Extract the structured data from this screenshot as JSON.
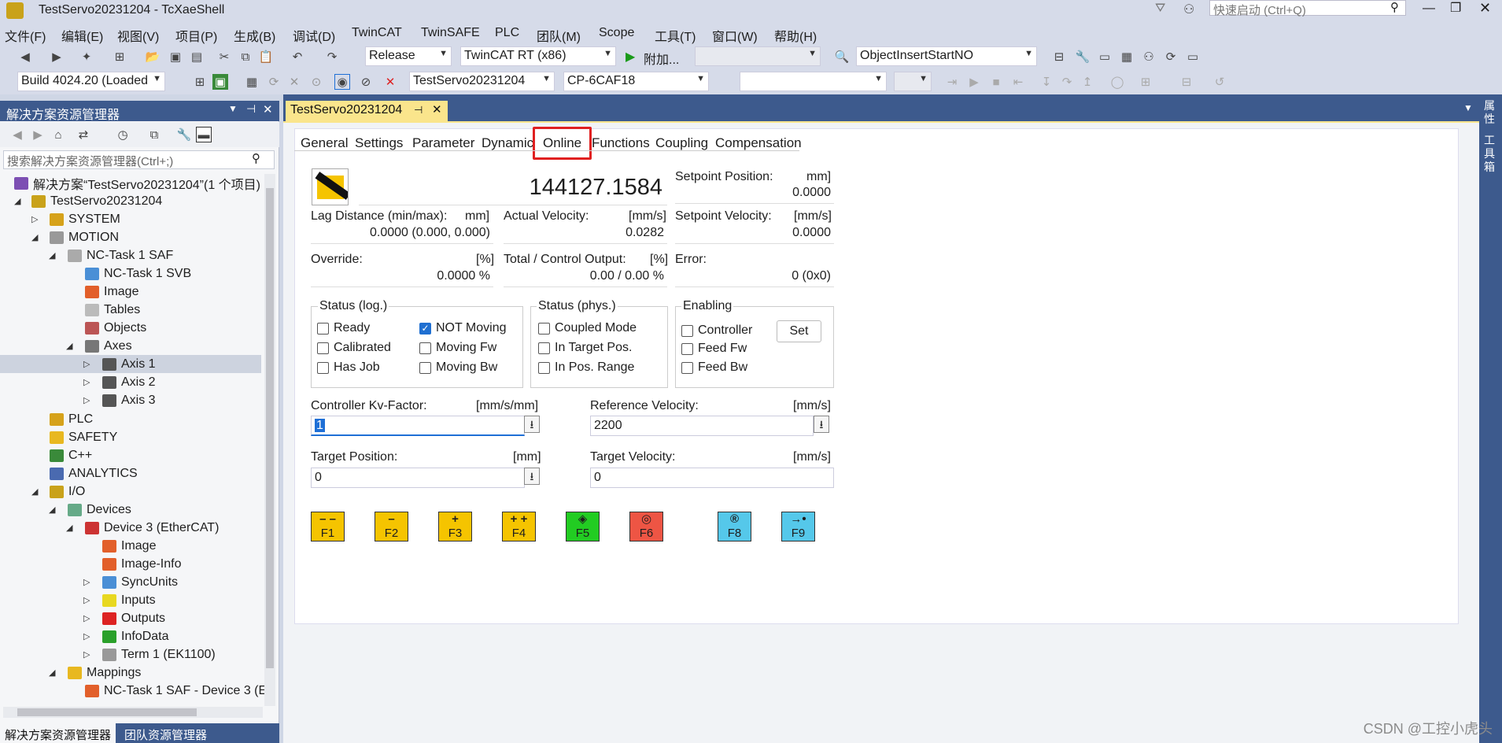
{
  "window": {
    "title": "TestServo20231204 - TcXaeShell",
    "quick_launch": "快速启动 (Ctrl+Q)"
  },
  "menu": [
    "文件(F)",
    "编辑(E)",
    "视图(V)",
    "项目(P)",
    "生成(B)",
    "调试(D)",
    "TwinCAT",
    "TwinSAFE",
    "PLC",
    "团队(M)",
    "Scope",
    "工具(T)",
    "窗口(W)",
    "帮助(H)"
  ],
  "toolbar": {
    "config": "Release",
    "platform": "TwinCAT RT (x86)",
    "attach": "附加...",
    "object_combo": "ObjectInsertStartNO",
    "build": "Build 4024.20 (Loaded",
    "project": "TestServo20231204",
    "target": "CP-6CAF18"
  },
  "solution_explorer": {
    "title": "解决方案资源管理器",
    "search_placeholder": "搜索解决方案资源管理器(Ctrl+;)",
    "items": [
      {
        "label": "解决方案“TestServo20231204”(1 个项目)"
      },
      {
        "label": "TestServo20231204"
      },
      {
        "label": "SYSTEM"
      },
      {
        "label": "MOTION"
      },
      {
        "label": "NC-Task 1 SAF"
      },
      {
        "label": "NC-Task 1 SVB"
      },
      {
        "label": "Image"
      },
      {
        "label": "Tables"
      },
      {
        "label": "Objects"
      },
      {
        "label": "Axes"
      },
      {
        "label": "Axis 1"
      },
      {
        "label": "Axis 2"
      },
      {
        "label": "Axis 3"
      },
      {
        "label": "PLC"
      },
      {
        "label": "SAFETY"
      },
      {
        "label": "C++"
      },
      {
        "label": "ANALYTICS"
      },
      {
        "label": "I/O"
      },
      {
        "label": "Devices"
      },
      {
        "label": "Device 3 (EtherCAT)"
      },
      {
        "label": "Image"
      },
      {
        "label": "Image-Info"
      },
      {
        "label": "SyncUnits"
      },
      {
        "label": "Inputs"
      },
      {
        "label": "Outputs"
      },
      {
        "label": "InfoData"
      },
      {
        "label": "Term 1 (EK1100)"
      },
      {
        "label": "Mappings"
      },
      {
        "label": "NC-Task 1 SAF - Device 3 (E"
      }
    ],
    "bottom_tabs": [
      "解决方案资源管理器",
      "团队资源管理器"
    ]
  },
  "right_strip": [
    "属性",
    "工具箱"
  ],
  "document": {
    "tab": "TestServo20231204",
    "subtabs": [
      "General",
      "Settings",
      "Parameter",
      "Dynamics",
      "Online",
      "Functions",
      "Coupling",
      "Compensation"
    ],
    "online": {
      "actual_position": "144127.1584",
      "setpoint_position_label": "Setpoint Position:",
      "setpoint_position_unit": "mm]",
      "setpoint_position": "0.0000",
      "lag_label": "Lag Distance (min/max):",
      "lag_unit": "mm]",
      "lag_value": "0.0000  (0.000, 0.000)",
      "actual_velocity_label": "Actual Velocity:",
      "actual_velocity_unit": "[mm/s]",
      "actual_velocity": "0.0282",
      "setpoint_velocity_label": "Setpoint Velocity:",
      "setpoint_velocity_unit": "[mm/s]",
      "setpoint_velocity": "0.0000",
      "override_label": "Override:",
      "override_unit": "[%]",
      "override_value": "0.0000 %",
      "output_label": "Total / Control Output:",
      "output_unit": "[%]",
      "output_value": "0.00 /  0.00 %",
      "error_label": "Error:",
      "error_value": "0 (0x0)",
      "status_log_title": "Status (log.)",
      "status_phys_title": "Status (phys.)",
      "enabling_title": "Enabling",
      "status_log": [
        {
          "label": "Ready",
          "checked": false
        },
        {
          "label": "NOT Moving",
          "checked": true
        },
        {
          "label": "Calibrated",
          "checked": false
        },
        {
          "label": "Moving Fw",
          "checked": false
        },
        {
          "label": "Has Job",
          "checked": false
        },
        {
          "label": "Moving Bw",
          "checked": false
        }
      ],
      "status_phys": [
        {
          "label": "Coupled Mode",
          "checked": false
        },
        {
          "label": "In Target Pos.",
          "checked": false
        },
        {
          "label": "In Pos. Range",
          "checked": false
        }
      ],
      "enabling": [
        {
          "label": "Controller",
          "checked": false
        },
        {
          "label": "Feed Fw",
          "checked": false
        },
        {
          "label": "Feed Bw",
          "checked": false
        }
      ],
      "set_button": "Set",
      "kv_label": "Controller Kv-Factor:",
      "kv_unit": "[mm/s/mm]",
      "kv_value": "1",
      "ref_vel_label": "Reference Velocity:",
      "ref_vel_unit": "[mm/s]",
      "ref_vel_value": "2200",
      "target_pos_label": "Target Position:",
      "target_pos_unit": "[mm]",
      "target_pos_value": "0",
      "target_vel_label": "Target Velocity:",
      "target_vel_unit": "[mm/s]",
      "target_vel_value": "0",
      "fkeys": [
        {
          "label": "F1",
          "symbol": "– –",
          "color": "#f5c400"
        },
        {
          "label": "F2",
          "symbol": "–",
          "color": "#f5c400"
        },
        {
          "label": "F3",
          "symbol": "+",
          "color": "#f5c400"
        },
        {
          "label": "F4",
          "symbol": "+ +",
          "color": "#f5c400"
        },
        {
          "label": "F5",
          "symbol": "◈",
          "color": "#22cc22"
        },
        {
          "label": "F6",
          "symbol": "◎",
          "color": "#ee5544"
        },
        {
          "label": "F8",
          "symbol": "®",
          "color": "#55c8ea"
        },
        {
          "label": "F9",
          "symbol": "→•",
          "color": "#55c8ea"
        }
      ]
    }
  },
  "watermark": "CSDN @工控小虎头"
}
